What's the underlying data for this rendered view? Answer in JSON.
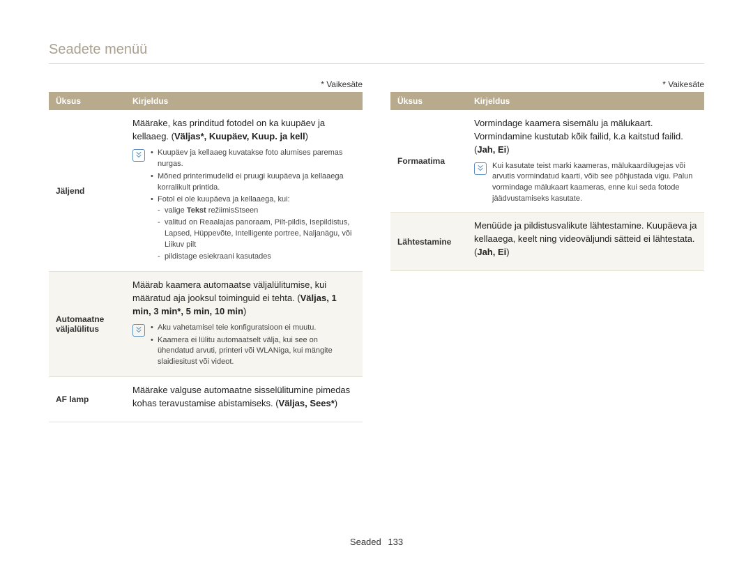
{
  "page_title": "Seadete menüü",
  "default_note": "* Vaikesäte",
  "table_headers": {
    "item": "Üksus",
    "desc": "Kirjeldus"
  },
  "left": {
    "row1": {
      "label": "Jäljend",
      "main_a": "Määrake, kas prinditud fotodel on ka kuupäev ja kellaaeg. (",
      "main_b": "Väljas*, Kuupäev, Kuup. ja kell",
      "main_c": ")",
      "notes": {
        "b1": "Kuupäev ja kellaaeg kuvatakse foto alumises paremas nurgas.",
        "b2": "Mõned printerimudelid ei pruugi kuupäeva ja kellaaega korralikult printida.",
        "b3": "Fotol ei ole kuupäeva ja kellaaega, kui:",
        "s1a": "valige ",
        "s1b": "Tekst",
        "s1c": " režiimisStseen",
        "s2": "valitud on Reaalajas panoraam, Pilt-pildis, Isepildistus, Lapsed, Hüppevõte, Intelligente portree, Naljanägu, või Liikuv pilt",
        "s3": "pildistage esiekraani kasutades"
      }
    },
    "row2": {
      "label": "Automaatne väljalülitus",
      "main_a": "Määrab kaamera automaatse väljalülitumise, kui määratud aja jooksul toiminguid ei tehta. (",
      "main_b": "Väljas, 1 min, 3 min*, 5 min, 10 min",
      "main_c": ")",
      "notes": {
        "b1": "Aku vahetamisel teie konfiguratsioon ei muutu.",
        "b2": "Kaamera ei lülitu automaatselt välja, kui see on ühendatud arvuti, printeri või WLANiga, kui mängite slaidiesitust või videot."
      }
    },
    "row3": {
      "label": "AF lamp",
      "main_a": "Määrake valguse automaatne sisselülitumine pimedas kohas teravustamise abistamiseks. (",
      "main_b": "Väljas, Sees*",
      "main_c": ")"
    }
  },
  "right": {
    "row1": {
      "label": "Formaatima",
      "main_a": "Vormindage kaamera sisemälu ja mälukaart. Vormindamine kustutab kõik failid, k.a kaitstud failid. (",
      "main_b": "Jah, Ei",
      "main_c": ")",
      "note": "Kui kasutate teist marki kaameras, mälukaardilugejas või arvutis vormindatud kaarti, võib see põhjustada vigu. Palun vormindage mälukaart kaameras, enne kui seda fotode jäädvustamiseks kasutate."
    },
    "row2": {
      "label": "Lähtestamine",
      "main_a": "Menüüde ja pildistusvalikute lähtestamine. Kuupäeva ja kellaaega, keelt ning videoväljundi sätteid ei lähtestata. (",
      "main_b": "Jah, Ei",
      "main_c": ")"
    }
  },
  "footer": {
    "section": "Seaded",
    "page": "133"
  }
}
